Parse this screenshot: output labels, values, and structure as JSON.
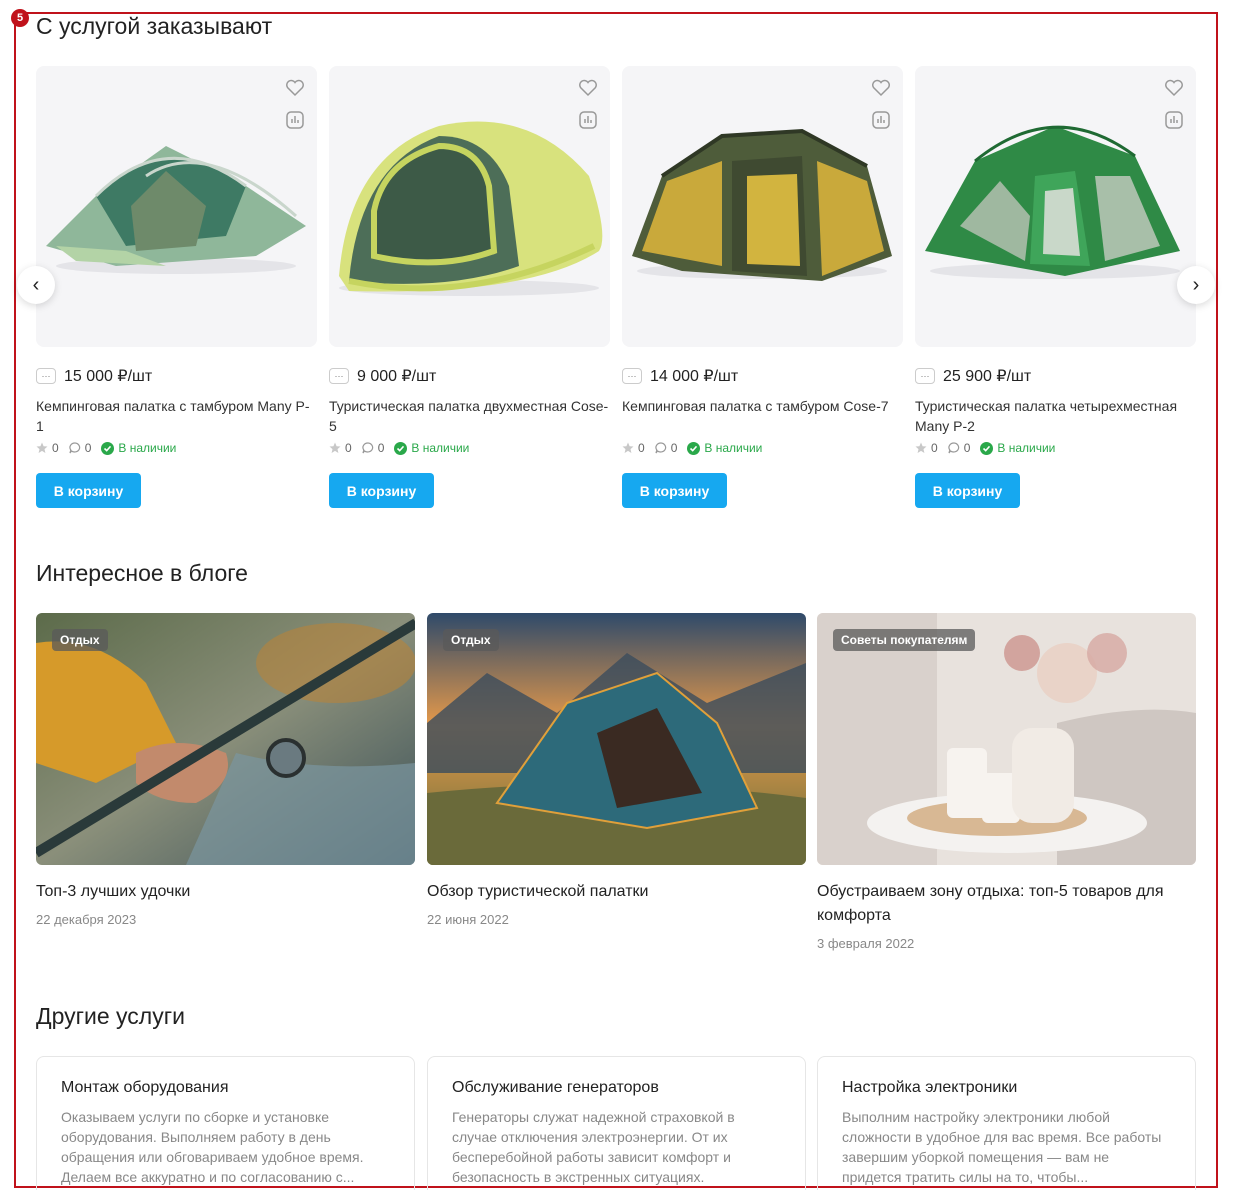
{
  "marker": "5",
  "recommend": {
    "title": "С услугой заказывают",
    "products": [
      {
        "price": "15 000 ₽/шт",
        "title": "Кемпинговая палатка с тамбуром Many P-1",
        "rating": "0",
        "reviews": "0",
        "stock": "В наличии",
        "button": "В корзину"
      },
      {
        "price": "9 000 ₽/шт",
        "title": "Туристическая палатка двухместная Cose-5",
        "rating": "0",
        "reviews": "0",
        "stock": "В наличии",
        "button": "В корзину"
      },
      {
        "price": "14 000 ₽/шт",
        "title": "Кемпинговая палатка с тамбуром Cose-7",
        "rating": "0",
        "reviews": "0",
        "stock": "В наличии",
        "button": "В корзину"
      },
      {
        "price": "25 900 ₽/шт",
        "title": "Туристическая палатка четырехместная Many P-2",
        "rating": "0",
        "reviews": "0",
        "stock": "В наличии",
        "button": "В корзину"
      }
    ],
    "price_chip": "···",
    "prev_arrow": "‹",
    "next_arrow": "›"
  },
  "blog": {
    "title": "Интересное в блоге",
    "posts": [
      {
        "tag": "Отдых",
        "title": "Топ-3 лучших удочки",
        "date": "22 декабря 2023"
      },
      {
        "tag": "Отдых",
        "title": "Обзор туристической палатки",
        "date": "22 июня 2022"
      },
      {
        "tag": "Советы покупателям",
        "title": "Обустраиваем зону отдыха: топ-5 товаров для комфорта",
        "date": "3 февраля 2022"
      }
    ]
  },
  "services": {
    "title": "Другие услуги",
    "items": [
      {
        "title": "Монтаж оборудования",
        "text": "Оказываем услуги по сборке и установке оборудования. Выполняем работу в день обращения или обговариваем удобное время. Делаем все аккуратно и по согласованию с..."
      },
      {
        "title": "Обслуживание генераторов",
        "text": "Генераторы служат надежной страховкой в случае отключения электроэнергии. От их бесперебойной работы зависит комфорт и безопасность в экстренных ситуациях."
      },
      {
        "title": "Настройка электроники",
        "text": "Выполним настройку электроники любой сложности в удобное для вас время. Все работы завершим уборкой помещения — вам не придется тратить силы на то, чтобы..."
      }
    ]
  },
  "colors": {
    "accent": "#16a8f0",
    "stock": "#2aa84a",
    "marker": "#c0121b"
  }
}
